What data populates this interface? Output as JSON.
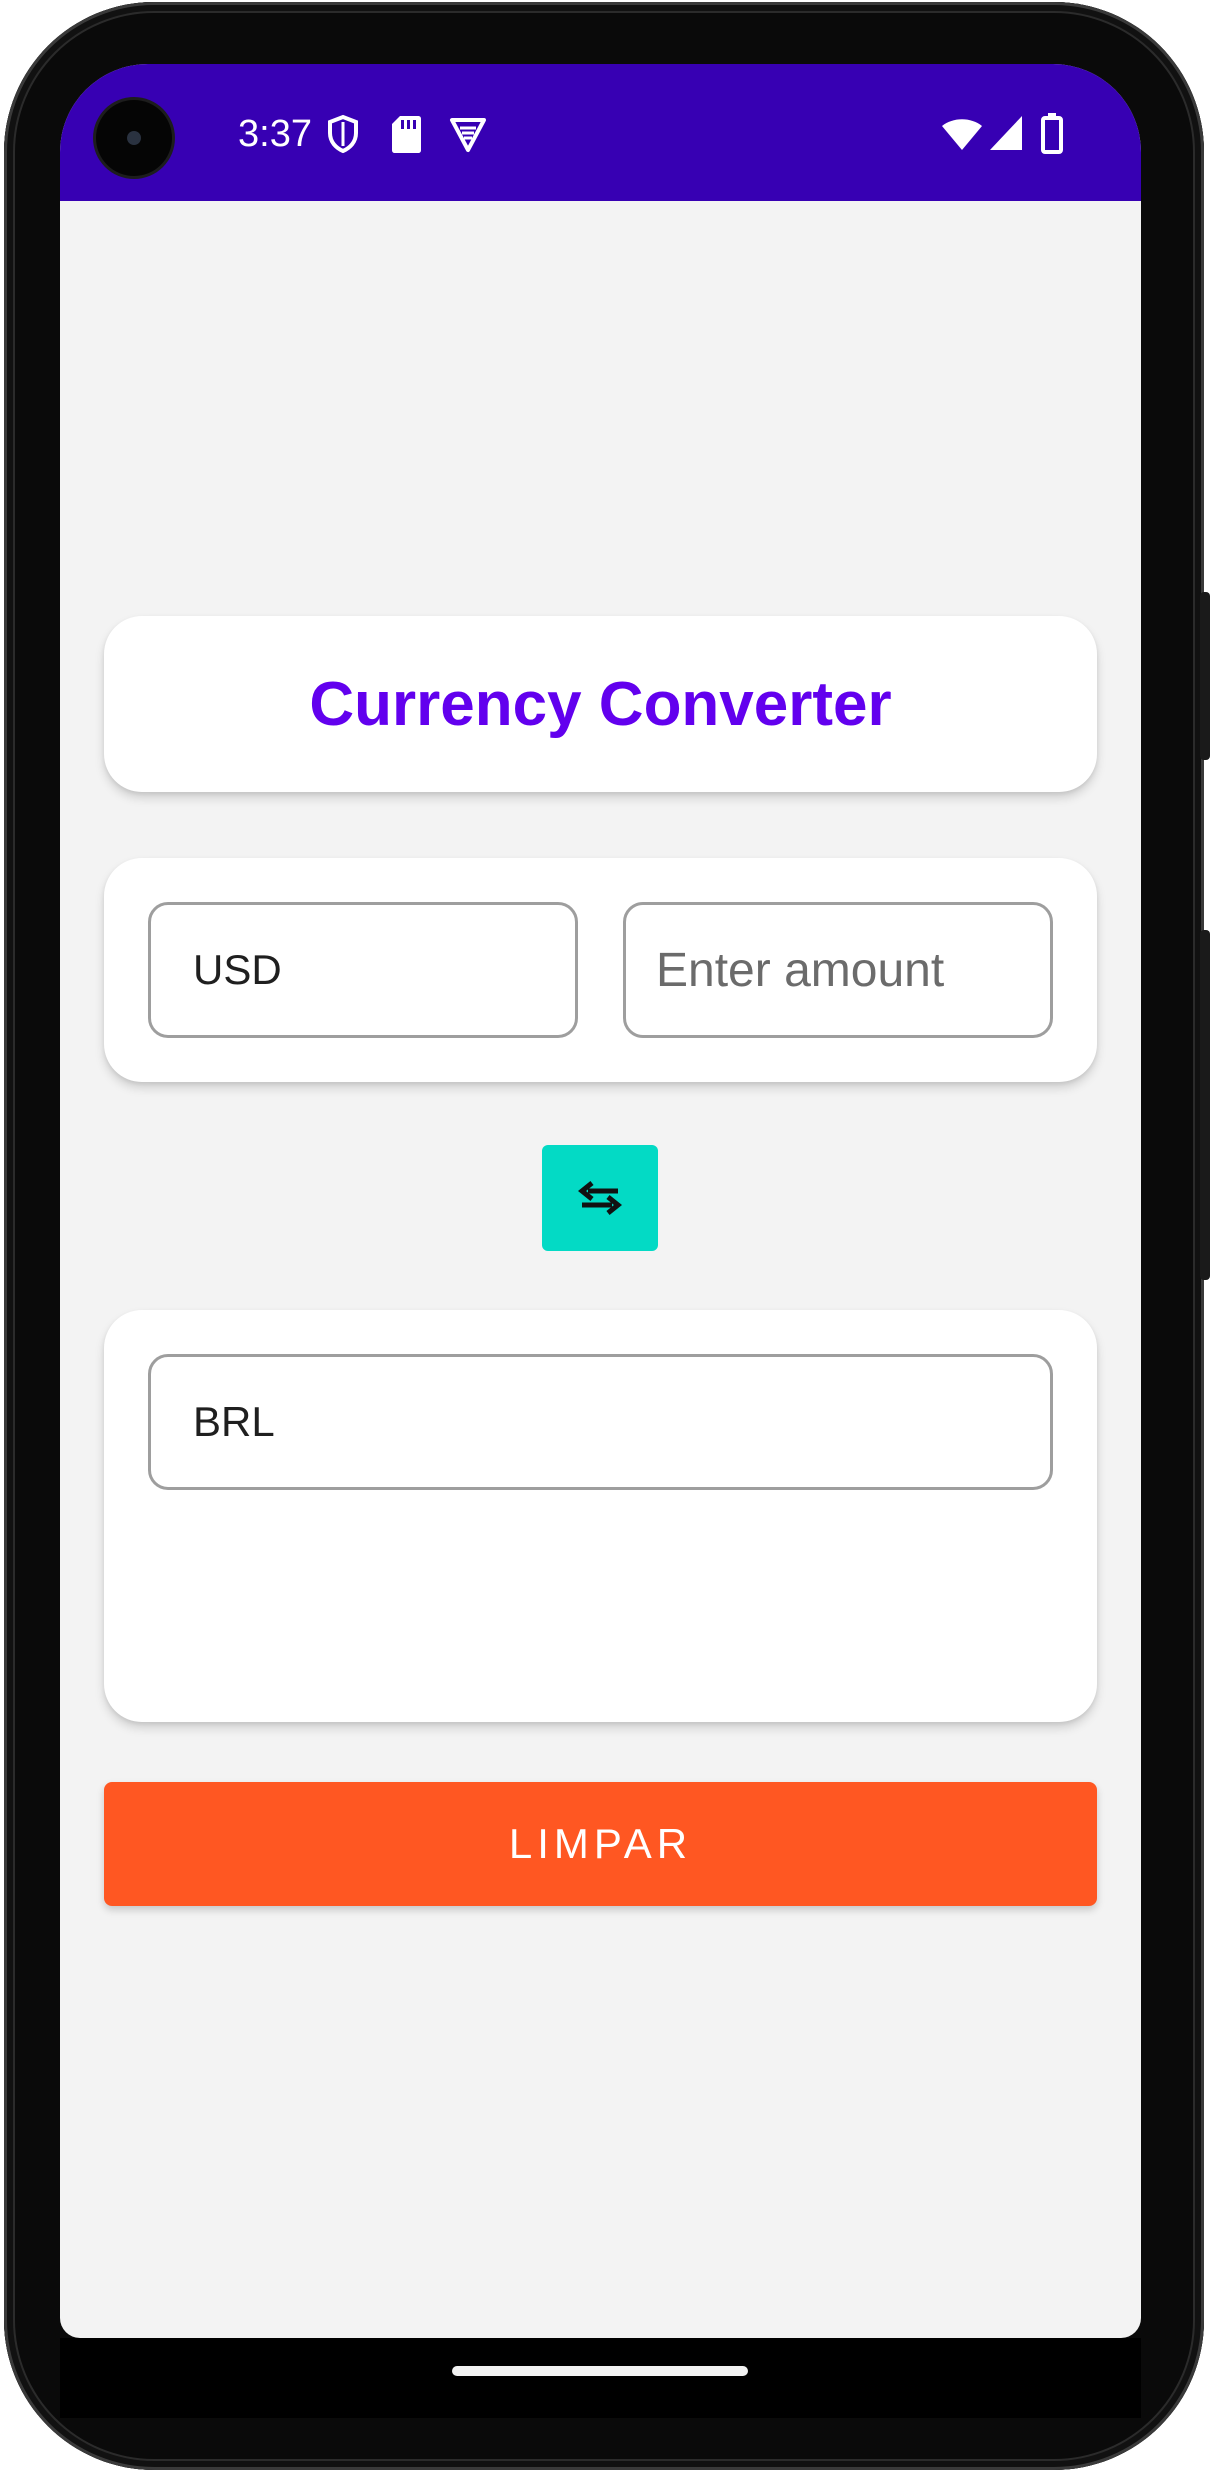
{
  "status_bar": {
    "time": "3:37",
    "icons": [
      "shield-icon",
      "sd-card-icon",
      "vpn-icon",
      "wifi-icon",
      "signal-icon",
      "battery-icon"
    ],
    "background": "#3700b3"
  },
  "header": {
    "title": "Currency Converter",
    "title_color": "#6200ee"
  },
  "converter": {
    "from_currency": "USD",
    "amount_placeholder": "Enter amount",
    "amount_value": "",
    "swap_icon": "swap-horizontal-icon",
    "swap_color": "#03dac5",
    "to_currency": "BRL",
    "result": ""
  },
  "actions": {
    "clear_label": "LIMPAR",
    "clear_color": "#ff5722"
  }
}
